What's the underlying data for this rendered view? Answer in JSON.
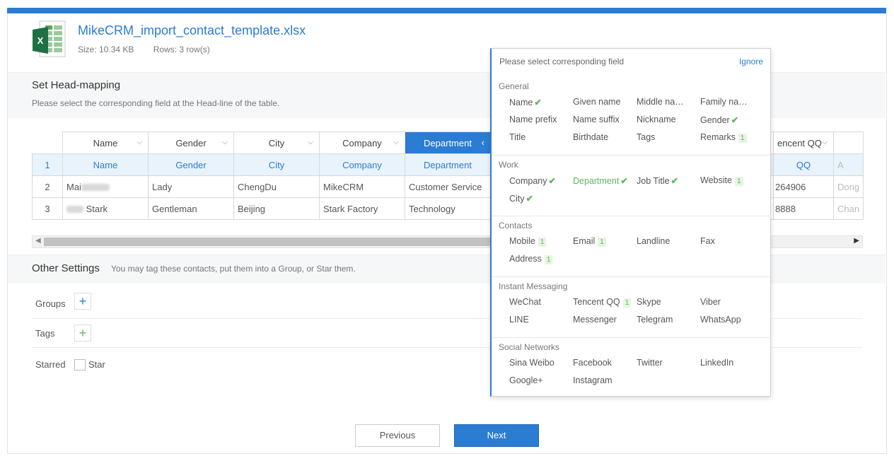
{
  "file": {
    "name": "MikeCRM_import_contact_template.xlsx",
    "size": "Size: 10.34 KB",
    "rows": "Rows: 3 row(s)",
    "icon": "excel-file-icon"
  },
  "head_mapping": {
    "title": "Set Head-mapping",
    "subtitle": "Please select the corresponding field at the Head-line of the table."
  },
  "table": {
    "headers": [
      "Name",
      "Gender",
      "City",
      "Company",
      "Department",
      "encent QQ",
      ""
    ],
    "mapping_row": [
      "1",
      "Name",
      "Gender",
      "City",
      "Company",
      "Department",
      "QQ",
      "A"
    ],
    "rows": [
      [
        "2",
        "Mai",
        "Lady",
        "ChengDu",
        "MikeCRM",
        "Customer Service",
        "264906",
        "Dong"
      ],
      [
        "3",
        "Stark",
        "Gentleman",
        "Beijing",
        "Stark Factory",
        "Technology",
        "8888",
        "Chan"
      ]
    ]
  },
  "other_settings": {
    "title": "Other Settings",
    "subtitle": "You may tag these contacts, put them into a Group, or Star them.",
    "groups_label": "Groups",
    "tags_label": "Tags",
    "starred_label": "Starred",
    "star_label": "Star"
  },
  "buttons": {
    "previous": "Previous",
    "next": "Next"
  },
  "popup": {
    "header": "Please select corresponding field",
    "ignore": "Ignore",
    "groups": [
      {
        "title": "General",
        "items": [
          {
            "label": "Name",
            "mark": "✔"
          },
          {
            "label": "Given name",
            "mark": ""
          },
          {
            "label": "Middle na…",
            "mark": ""
          },
          {
            "label": "Family na…",
            "mark": ""
          },
          {
            "label": "Name prefix",
            "mark": ""
          },
          {
            "label": "Name suffix",
            "mark": ""
          },
          {
            "label": "Nickname",
            "mark": ""
          },
          {
            "label": "Gender",
            "mark": "✔"
          },
          {
            "label": "Title",
            "mark": ""
          },
          {
            "label": "Birthdate",
            "mark": ""
          },
          {
            "label": "Tags",
            "mark": ""
          },
          {
            "label": "Remarks",
            "mark": "1"
          }
        ]
      },
      {
        "title": "Work",
        "items": [
          {
            "label": "Company",
            "mark": "✔"
          },
          {
            "label": "Department",
            "mark": "✔",
            "used": true
          },
          {
            "label": "Job Title",
            "mark": "✔"
          },
          {
            "label": "Website",
            "mark": "1"
          },
          {
            "label": "City",
            "mark": "✔"
          }
        ]
      },
      {
        "title": "Contacts",
        "items": [
          {
            "label": "Mobile",
            "mark": "1"
          },
          {
            "label": "Email",
            "mark": "1"
          },
          {
            "label": "Landline",
            "mark": ""
          },
          {
            "label": "Fax",
            "mark": ""
          },
          {
            "label": "Address",
            "mark": "1"
          }
        ]
      },
      {
        "title": "Instant Messaging",
        "items": [
          {
            "label": "WeChat",
            "mark": ""
          },
          {
            "label": "Tencent QQ",
            "mark": "1"
          },
          {
            "label": "Skype",
            "mark": ""
          },
          {
            "label": "Viber",
            "mark": ""
          },
          {
            "label": "LINE",
            "mark": ""
          },
          {
            "label": "Messenger",
            "mark": ""
          },
          {
            "label": "Telegram",
            "mark": ""
          },
          {
            "label": "WhatsApp",
            "mark": ""
          }
        ]
      },
      {
        "title": "Social Networks",
        "items": [
          {
            "label": "Sina Weibo",
            "mark": ""
          },
          {
            "label": "Facebook",
            "mark": ""
          },
          {
            "label": "Twitter",
            "mark": ""
          },
          {
            "label": "LinkedIn",
            "mark": ""
          },
          {
            "label": "Google+",
            "mark": ""
          },
          {
            "label": "Instagram",
            "mark": ""
          }
        ]
      }
    ]
  },
  "colors": {
    "accent": "#2b7cd3",
    "check": "#5cb85c",
    "map_row": "#e8f3fc"
  }
}
